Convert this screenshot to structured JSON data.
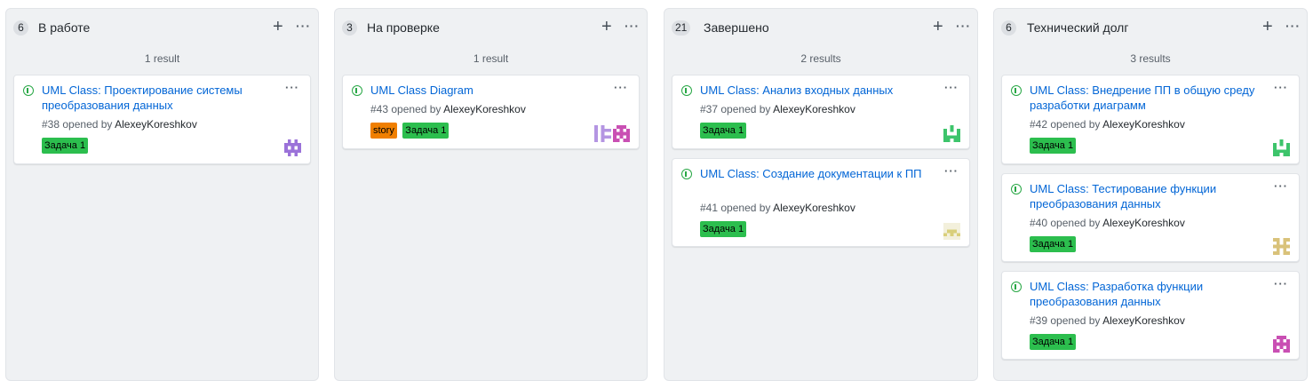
{
  "columns": [
    {
      "count": "6",
      "title": "В работе",
      "results": "1 result",
      "cards": [
        {
          "title": "UML Class: Проектирование системы преобразования данных",
          "number": "#38",
          "opened_by": "opened by",
          "author": "AlexeyKoreshkov",
          "labels": [
            {
              "text": "Задача 1",
              "color": "#2cbe4e"
            }
          ],
          "avatar_color": "#9b72d9"
        }
      ]
    },
    {
      "count": "3",
      "title": "На проверке",
      "results": "1 result",
      "cards": [
        {
          "title": "UML Class Diagram",
          "number": "#43",
          "opened_by": "opened by",
          "author": "AlexeyKoreshkov",
          "labels": [
            {
              "text": "story",
              "color": "#f07f00"
            },
            {
              "text": "Задача 1",
              "color": "#2cbe4e"
            }
          ],
          "avatar_color": "#c94fb3"
        }
      ]
    },
    {
      "count": "21",
      "title": "Завершено",
      "results": "2 results",
      "cards": [
        {
          "title": "UML Class: Анализ входных данных",
          "number": "#37",
          "opened_by": "opened by",
          "author": "AlexeyKoreshkov",
          "labels": [
            {
              "text": "Задача 1",
              "color": "#2cbe4e"
            }
          ],
          "avatar_color": "#3dc46b"
        },
        {
          "title": "UML Class: Создание документации к ПП",
          "number": "#41",
          "opened_by": "opened by",
          "author": "AlexeyKoreshkov",
          "labels": [
            {
              "text": "Задача 1",
              "color": "#2cbe4e"
            }
          ],
          "avatar_color": "#d9cf7a"
        }
      ]
    },
    {
      "count": "6",
      "title": "Технический долг",
      "results": "3 results",
      "cards": [
        {
          "title": "UML Class: Внедрение ПП в общую среду разработки диаграмм",
          "number": "#42",
          "opened_by": "opened by",
          "author": "AlexeyKoreshkov",
          "labels": [
            {
              "text": "Задача 1",
              "color": "#2cbe4e"
            }
          ],
          "avatar_color": "#3dc46b"
        },
        {
          "title": "UML Class: Тестирование функции преобразования данных",
          "number": "#40",
          "opened_by": "opened by",
          "author": "AlexeyKoreshkov",
          "labels": [
            {
              "text": "Задача 1",
              "color": "#2cbe4e"
            }
          ],
          "avatar_color": "#d9c27a"
        },
        {
          "title": "UML Class: Разработка функции преобразования данных",
          "number": "#39",
          "opened_by": "opened by",
          "author": "AlexeyKoreshkov",
          "labels": [
            {
              "text": "Задача 1",
              "color": "#2cbe4e"
            }
          ],
          "avatar_color": "#c94fb3"
        }
      ]
    }
  ],
  "icons": {
    "add": "plus-icon",
    "more": "kebab-icon",
    "issue": "issue-opened-icon",
    "avatar": "identicon-avatar"
  },
  "plus_glyph": "+",
  "more_glyph": "···"
}
